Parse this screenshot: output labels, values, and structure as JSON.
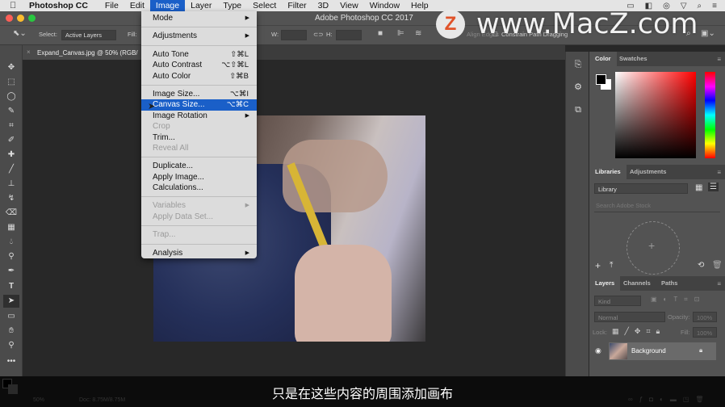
{
  "menubar": {
    "apple": "",
    "app_name": "Photoshop CC",
    "items": [
      "File",
      "Edit",
      "Image",
      "Layer",
      "Type",
      "Select",
      "Filter",
      "3D",
      "View",
      "Window",
      "Help"
    ],
    "active_item": "Image",
    "status_icons": [
      "display-icon",
      "camera-icon",
      "creative-cloud-icon",
      "wifi-icon",
      "spotlight-search-icon",
      "notification-list-icon"
    ]
  },
  "window": {
    "title": "Adobe Photoshop CC 2017"
  },
  "options_bar": {
    "select_label": "Select:",
    "select_value": "Active Layers",
    "fill_label": "Fill:",
    "w_label": "W:",
    "h_label": "H:",
    "align_edges": "Align Edges",
    "constrain": "Constrain Path Dragging"
  },
  "document": {
    "tab_title": "Expand_Canvas.jpg @ 50% (RGB/"
  },
  "image_menu": {
    "groups": [
      [
        {
          "label": "Mode",
          "submenu": true
        }
      ],
      [
        {
          "label": "Adjustments",
          "submenu": true
        }
      ],
      [
        {
          "label": "Auto Tone",
          "shortcut": "⇧⌘L"
        },
        {
          "label": "Auto Contrast",
          "shortcut": "⌥⇧⌘L"
        },
        {
          "label": "Auto Color",
          "shortcut": "⇧⌘B"
        }
      ],
      [
        {
          "label": "Image Size...",
          "shortcut": "⌥⌘I"
        },
        {
          "label": "Canvas Size...",
          "shortcut": "⌥⌘C",
          "highlighted": true
        },
        {
          "label": "Image Rotation",
          "submenu": true
        },
        {
          "label": "Crop",
          "disabled": true
        },
        {
          "label": "Trim..."
        },
        {
          "label": "Reveal All",
          "disabled": true
        }
      ],
      [
        {
          "label": "Duplicate..."
        },
        {
          "label": "Apply Image..."
        },
        {
          "label": "Calculations..."
        }
      ],
      [
        {
          "label": "Variables",
          "submenu": true,
          "disabled": true
        },
        {
          "label": "Apply Data Set...",
          "disabled": true
        }
      ],
      [
        {
          "label": "Trap...",
          "disabled": true
        }
      ],
      [
        {
          "label": "Analysis",
          "submenu": true
        }
      ]
    ]
  },
  "tools": [
    "move",
    "marquee",
    "lasso",
    "quick-selection",
    "crop",
    "eyedropper",
    "healing-brush",
    "brush",
    "clone-stamp",
    "history-brush",
    "eraser",
    "gradient",
    "blur",
    "dodge",
    "pen",
    "type",
    "path-selection",
    "rectangle",
    "hand",
    "zoom",
    "more"
  ],
  "color_panel": {
    "tabs": [
      "Color",
      "Swatches"
    ],
    "active": "Color",
    "foreground": "#000000",
    "background": "#ffffff"
  },
  "libraries_panel": {
    "tabs": [
      "Libraries",
      "Adjustments"
    ],
    "active": "Libraries",
    "library_select": "Library",
    "search_placeholder": "Search Adobe Stock"
  },
  "layers_panel": {
    "tabs": [
      "Layers",
      "Channels",
      "Paths"
    ],
    "active": "Layers",
    "filter": "Kind",
    "blend_mode": "Normal",
    "opacity_label": "Opacity:",
    "opacity_value": "100%",
    "lock_label": "Lock:",
    "fill_label": "Fill:",
    "fill_value": "100%",
    "layers": [
      {
        "name": "Background",
        "visible": true,
        "locked": true
      }
    ]
  },
  "status_bar": {
    "zoom": "50%",
    "doc": "Doc: 8.75M/8.75M"
  },
  "subtitle": "只是在这些内容的周围添加画布",
  "watermark": {
    "logo": "Z",
    "text": "www.MacZ.com"
  }
}
